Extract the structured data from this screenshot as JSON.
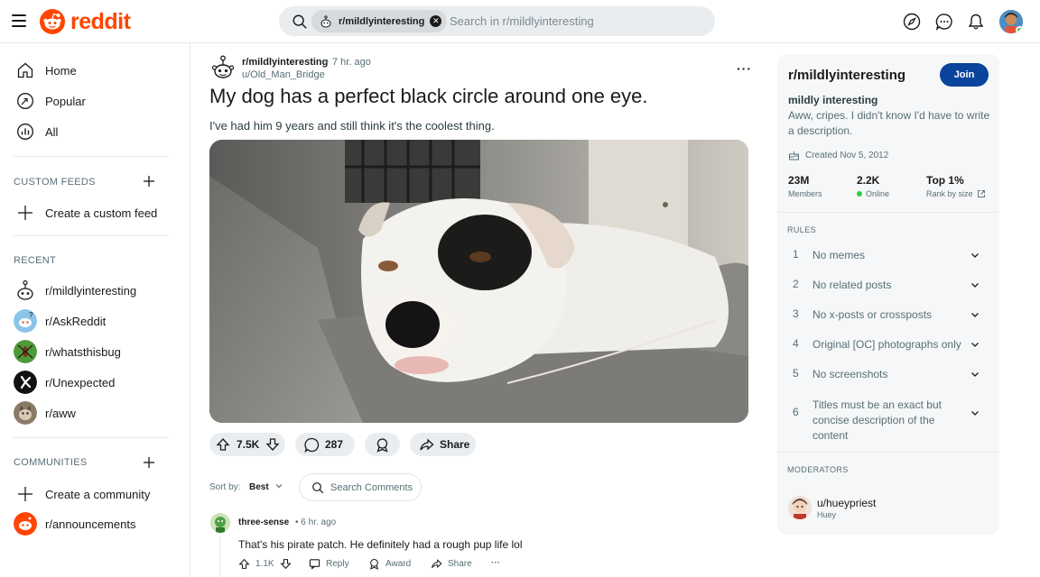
{
  "header": {
    "logo_text": "reddit",
    "search_chip": "r/mildlyinteresting",
    "search_placeholder": "Search in r/mildlyinteresting"
  },
  "left_nav": {
    "items": [
      {
        "label": "Home",
        "icon": "home-icon"
      },
      {
        "label": "Popular",
        "icon": "popular-icon"
      },
      {
        "label": "All",
        "icon": "all-icon"
      }
    ],
    "custom_feeds_title": "CUSTOM FEEDS",
    "create_custom_feed": "Create a custom feed",
    "recent_title": "RECENT",
    "recent": [
      {
        "label": "r/mildlyinteresting"
      },
      {
        "label": "r/AskReddit"
      },
      {
        "label": "r/whatsthisbug"
      },
      {
        "label": "r/Unexpected"
      },
      {
        "label": "r/aww"
      }
    ],
    "communities_title": "COMMUNITIES",
    "create_community": "Create a community",
    "announcements": "r/announcements"
  },
  "post": {
    "subreddit": "r/mildlyinteresting",
    "separator": "•",
    "time": "7 hr. ago",
    "author": "u/Old_Man_Bridge",
    "more": "···",
    "title": "My dog has a perfect black circle around one eye.",
    "body": "I've had him 9 years and still think it's the coolest thing.",
    "votes": "7.5K",
    "comments": "287",
    "share": "Share"
  },
  "comments_bar": {
    "sort_label": "Sort by:",
    "sort_value": "Best",
    "search_placeholder": "Search Comments"
  },
  "comment": {
    "user": "three-sense",
    "time": "• 6 hr. ago",
    "text": "That's his pirate patch. He definitely had a rough pup life lol",
    "votes": "1.1K",
    "reply": "Reply",
    "award": "Award",
    "share": "Share",
    "more": "···"
  },
  "sidebar": {
    "title": "r/mildlyinteresting",
    "join": "Join",
    "subtitle": "mildly interesting",
    "description": "Aww, cripes. I didn't know I'd have to write a description.",
    "created": "Created Nov 5, 2012",
    "stats": [
      {
        "value": "23M",
        "label": "Members"
      },
      {
        "value": "2.2K",
        "label": "Online"
      },
      {
        "value": "Top 1%",
        "label": "Rank by size"
      }
    ],
    "rules_title": "RULES",
    "rules": [
      {
        "n": "1",
        "text": "No memes"
      },
      {
        "n": "2",
        "text": "No related posts"
      },
      {
        "n": "3",
        "text": "No x-posts or crossposts"
      },
      {
        "n": "4",
        "text": "Original [OC] photographs only"
      },
      {
        "n": "5",
        "text": "No screenshots"
      },
      {
        "n": "6",
        "text": "Titles must be an exact but concise description of the content"
      }
    ],
    "moderators_title": "MODERATORS",
    "moderator": {
      "name": "u/hueypriest",
      "flair": "Huey"
    }
  },
  "colors": {
    "brand": "#ff4500",
    "join": "#0a449b",
    "online": "#2ecc40"
  }
}
